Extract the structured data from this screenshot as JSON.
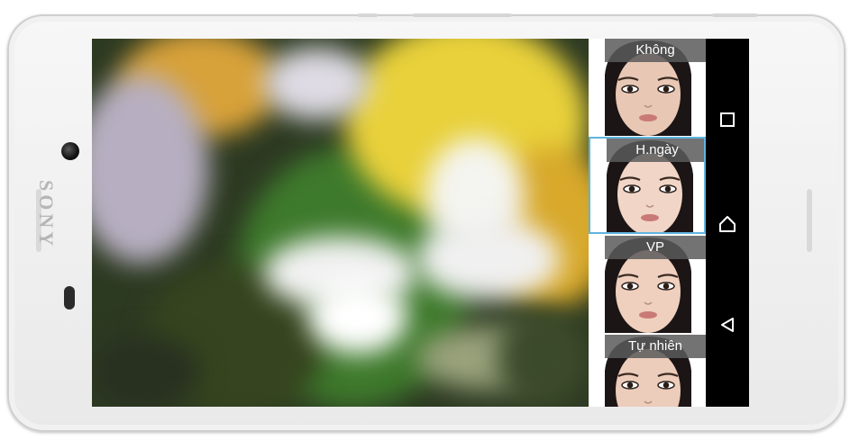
{
  "device": {
    "brand_text": "SONY"
  },
  "effects": {
    "items": [
      {
        "label": "Không",
        "selected": false
      },
      {
        "label": "H.ngày",
        "selected": true
      },
      {
        "label": "VP",
        "selected": false
      },
      {
        "label": "Tự nhiên",
        "selected": false
      }
    ]
  },
  "navigation": {
    "recents_icon": "square-icon",
    "home_icon": "home-icon",
    "back_icon": "back-triangle-icon"
  },
  "colors": {
    "selection_border": "#60b4df",
    "label_bg": "#5a5a5a",
    "navbar_bg": "#000000"
  }
}
